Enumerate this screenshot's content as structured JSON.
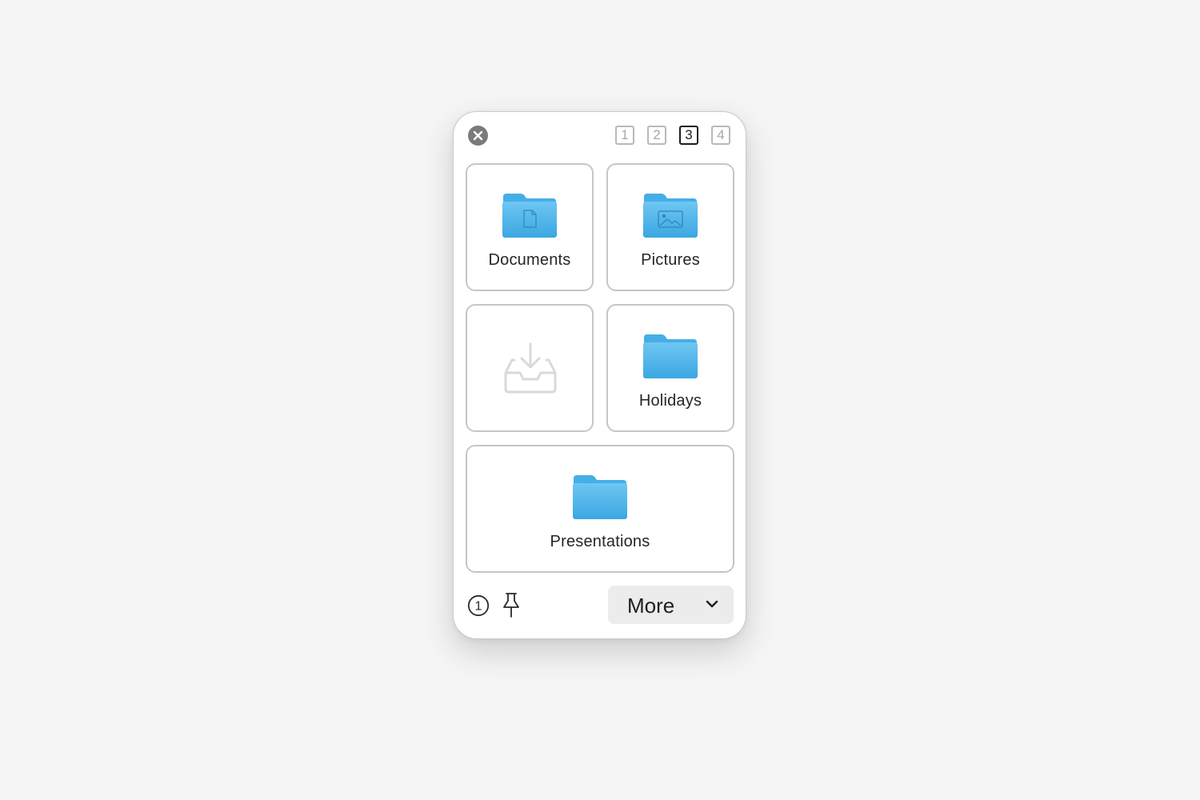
{
  "window": {
    "close_icon": "close-icon"
  },
  "pages": [
    {
      "label": "1",
      "active": false
    },
    {
      "label": "2",
      "active": false
    },
    {
      "label": "3",
      "active": true
    },
    {
      "label": "4",
      "active": false
    }
  ],
  "tiles": [
    {
      "label": "Documents",
      "icon": "folder-document-icon"
    },
    {
      "label": "Pictures",
      "icon": "folder-pictures-icon"
    },
    {
      "label": "",
      "icon": "inbox-tray-icon"
    },
    {
      "label": "Holidays",
      "icon": "folder-icon"
    },
    {
      "label": "Presentations",
      "icon": "folder-icon"
    }
  ],
  "footer": {
    "badge": "1",
    "pin_icon": "pin-icon",
    "more_label": "More",
    "more_icon": "chevron-down-icon"
  },
  "colors": {
    "folder_top": "#6fc6f2",
    "folder_bottom": "#3aa7e2",
    "accent_active": "#1e1e1e"
  }
}
